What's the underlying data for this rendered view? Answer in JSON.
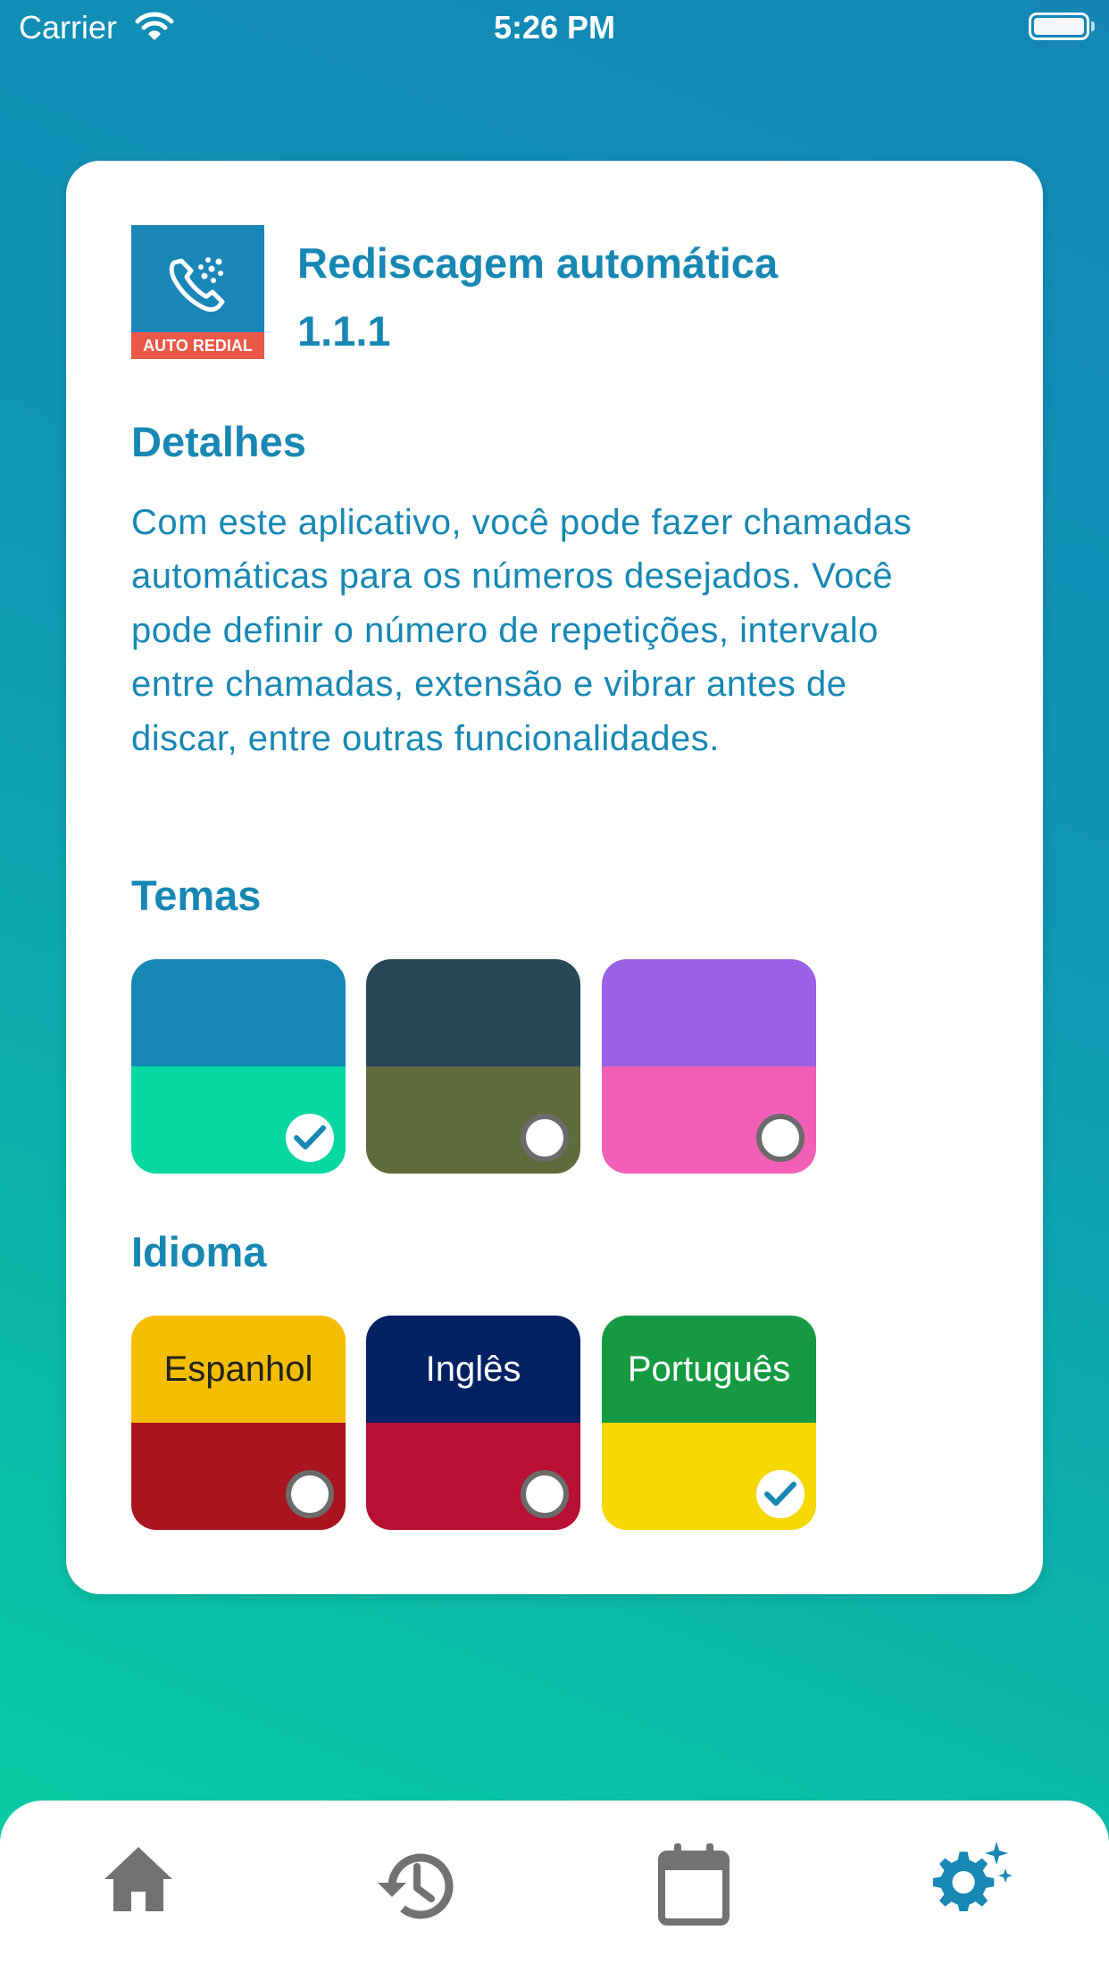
{
  "status_bar": {
    "carrier": "Carrier",
    "time": "5:26 PM"
  },
  "app": {
    "icon_label": "AUTO REDIAL",
    "title": "Rediscagem automática",
    "version": "1.1.1"
  },
  "details": {
    "heading": "Detalhes",
    "text": "Com este aplicativo, você pode fazer chamadas automáticas para os números desejados. Você pode definir o número de repetições, intervalo entre chamadas, extensão e vibrar antes de discar, entre outras funcionalidades."
  },
  "themes": {
    "heading": "Temas",
    "items": [
      {
        "top_color": "#1488b3",
        "bottom_color": "#08d7a2",
        "selected": true
      },
      {
        "top_color": "#284757",
        "bottom_color": "#5f6b3a",
        "selected": false
      },
      {
        "top_color": "#9a60e5",
        "bottom_color": "#f25fb7",
        "selected": false
      }
    ]
  },
  "language": {
    "heading": "Idioma",
    "items": [
      {
        "label": "Espanhol",
        "top_color": "#f4bd00",
        "bottom_color": "#a9151e",
        "text_color": "#222222",
        "selected": false
      },
      {
        "label": "Inglês",
        "top_color": "#012163",
        "bottom_color": "#b80f32",
        "text_color": "#ffffff",
        "selected": false
      },
      {
        "label": "Português",
        "top_color": "#159a42",
        "bottom_color": "#f5d800",
        "text_color": "#ffffff",
        "selected": true
      }
    ]
  },
  "tabbar": {
    "items": [
      {
        "icon": "home-icon",
        "active": false
      },
      {
        "icon": "history-icon",
        "active": false
      },
      {
        "icon": "calendar-icon",
        "active": false
      },
      {
        "icon": "settings-sparkle-icon",
        "active": true
      }
    ],
    "active_color": "#1787b3",
    "inactive_color": "#727272"
  }
}
